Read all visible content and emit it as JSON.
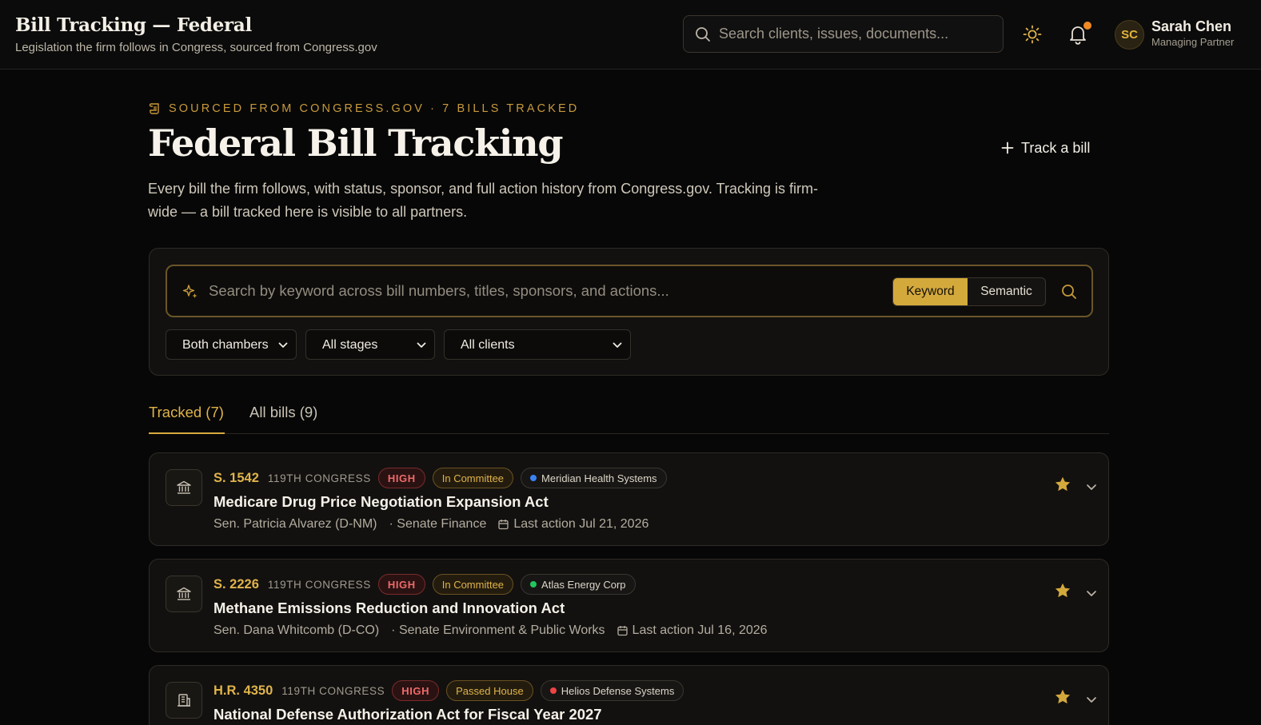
{
  "app": {
    "title": "Bill Tracking — Federal",
    "subtitle": "Legislation the firm follows in Congress, sourced from Congress.gov"
  },
  "header": {
    "search_placeholder": "Search clients, issues, documents...",
    "theme_icon": "sun-icon",
    "notification_icon": "bell-icon",
    "accent_color": "#d4a93c",
    "notification_dot_color": "#f08a24",
    "user": {
      "initials": "SC",
      "name": "Sarah Chen",
      "role": "Managing Partner"
    }
  },
  "page": {
    "eyebrow": "SOURCED FROM CONGRESS.GOV · 7 BILLS TRACKED",
    "title": "Federal Bill Tracking",
    "description": "Every bill the firm follows, with status, sponsor, and full action history from Congress.gov. Tracking is firm-wide — a bill tracked here is visible to all partners.",
    "track_button": "Track a bill"
  },
  "filters": {
    "search_placeholder": "Search by keyword across bill numbers, titles, sponsors, and actions...",
    "modes": {
      "keyword": "Keyword",
      "semantic": "Semantic",
      "selected": "Keyword"
    },
    "chamber": "Both chambers",
    "stage": "All stages",
    "client": "All clients"
  },
  "tabs": {
    "tracked": "Tracked (7)",
    "all": "All bills (9)",
    "selected": "Tracked (7)"
  },
  "bills": [
    {
      "number": "S. 1542",
      "congress": "119TH CONGRESS",
      "priority": "HIGH",
      "stage": "In Committee",
      "client": "Meridian Health Systems",
      "client_color": "#3b82f6",
      "title": "Medicare Drug Price Negotiation Expansion Act",
      "sponsor": "Sen. Patricia Alvarez (D-NM)",
      "committee": "· Senate Finance",
      "last_action": "Last action Jul 21, 2026",
      "icon": "capitol-icon",
      "starred": true
    },
    {
      "number": "S. 2226",
      "congress": "119TH CONGRESS",
      "priority": "HIGH",
      "stage": "In Committee",
      "client": "Atlas Energy Corp",
      "client_color": "#22c55e",
      "title": "Methane Emissions Reduction and Innovation Act",
      "sponsor": "Sen. Dana Whitcomb (D-CO)",
      "committee": "· Senate Environment & Public Works",
      "last_action": "Last action Jul 16, 2026",
      "icon": "capitol-icon",
      "starred": true
    },
    {
      "number": "H.R. 4350",
      "congress": "119TH CONGRESS",
      "priority": "HIGH",
      "stage": "Passed House",
      "client": "Helios Defense Systems",
      "client_color": "#ef4444",
      "title": "National Defense Authorization Act for Fiscal Year 2027",
      "icon": "building-icon",
      "starred": true
    }
  ]
}
